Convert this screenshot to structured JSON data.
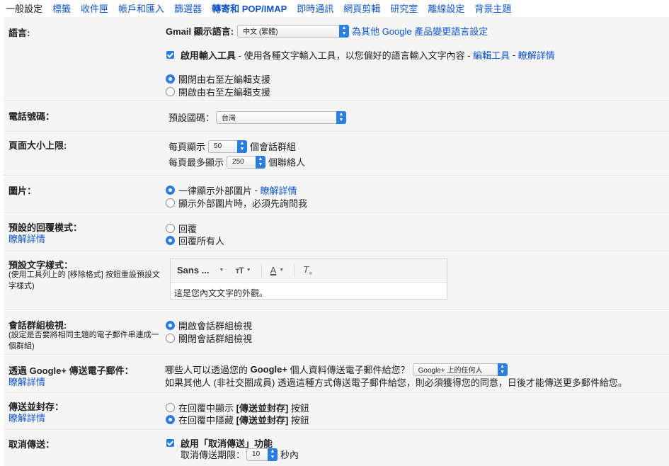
{
  "tabs": [
    "一般設定",
    "標籤",
    "收件匣",
    "帳戶和匯入",
    "篩選器",
    "轉寄和 POP/IMAP",
    "即時通訊",
    "網頁剪輯",
    "研究室",
    "離線設定",
    "背景主題"
  ],
  "language": {
    "label": "語言:",
    "display_label": "Gmail 顯示語言:",
    "selected": "中文 (繁體)",
    "change_link": "為其他 Google 產品變更語言設定",
    "input_tools_label": "啟用輸入工具",
    "input_tools_desc": " - 使用各種文字輸入工具，以您偏好的語言輸入文字內容 - ",
    "edit_tools": "編輯工具",
    "sep": " - ",
    "learn_more": "瞭解詳情",
    "rtl_off": "關閉由右至左編輯支援",
    "rtl_on": "開啟由右至左編輯支援"
  },
  "phone": {
    "label": "電話號碼：",
    "default_country": "預設國碼：",
    "selected": "台灣"
  },
  "page_size": {
    "label": "頁面大小上限:",
    "show_prefix": "每頁顯示",
    "show_value": "50",
    "show_suffix": "個會話群組",
    "contacts_prefix": "每頁最多顯示",
    "contacts_value": "250",
    "contacts_suffix": "個聯絡人"
  },
  "images": {
    "label": "圖片：",
    "always": "一律顯示外部圖片",
    "sep": " - ",
    "learn_more": "瞭解詳情",
    "ask": "顯示外部圖片時，必須先詢問我"
  },
  "reply": {
    "label": "預設的回覆模式：",
    "learn_more": "瞭解詳情",
    "reply": "回覆",
    "reply_all": "回覆所有人"
  },
  "text_style": {
    "label": "預設文字樣式：",
    "note": "(使用工具列上的 [移除格式] 按鈕重設預設文字樣式)",
    "font": "Sans ...",
    "preview": "這是您內文文字的外觀。"
  },
  "conversation": {
    "label": "會話群組檢視:",
    "note": "(設定是否要將相同主題的電子郵件串連成一個群組)",
    "on": "開啟會話群組檢視",
    "off": "關閉會話群組檢視"
  },
  "gplus": {
    "label": "透過 Google+ 傳送電子郵件：",
    "learn_more": "瞭解詳情",
    "question_pre": "哪些人可以透過您的 ",
    "question_bold": "Google+",
    "question_post": " 個人資料傳送電子郵件給您？",
    "selected": "Google+ 上的任何人",
    "desc": "如果其他人 (非社交圈成員) 透過這種方式傳送電子郵件給您，則必須獲得您的同意，日後才能傳送更多郵件給您。"
  },
  "send_archive": {
    "label": "傳送並封存：",
    "learn_more": "瞭解詳情",
    "show_pre": "在回覆中顯示 ",
    "show_bold": "[傳送並封存]",
    "show_post": " 按鈕",
    "hide_pre": "在回覆中隱藏 ",
    "hide_bold": "[傳送並封存]",
    "hide_post": " 按鈕"
  },
  "undo_send": {
    "label": "取消傳送：",
    "enable": "啟用「取消傳送」功能",
    "period_label": "取消傳送期限：",
    "period_value": "10",
    "period_suffix": "秒內"
  }
}
